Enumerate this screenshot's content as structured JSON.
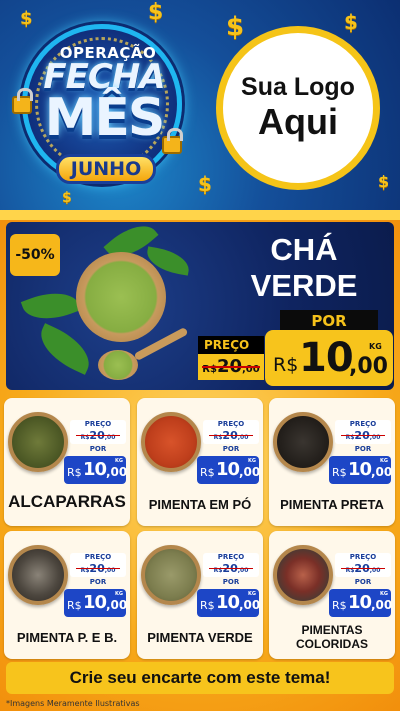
{
  "header": {
    "badge": {
      "line1": "OPERAÇÃO",
      "line2": "FECHA",
      "line3": "MÊS",
      "month": "JUNHO"
    },
    "logo": {
      "line1": "Sua Logo",
      "line2": "Aqui"
    },
    "dollar_symbol": "$"
  },
  "feature": {
    "discount": "-50%",
    "title_line1": "CHÁ",
    "title_line2": "VERDE",
    "por_label": "POR",
    "preco_label": "PREÇO",
    "old_currency": "R$",
    "old_price": "20",
    "old_cents": ",00",
    "currency": "R$",
    "price_int": "10",
    "price_dec": ",00",
    "unit": "KG"
  },
  "cards": [
    {
      "name": "ALCAPARRAS",
      "preco_label": "PREÇO",
      "old_currency": "R$",
      "old_price": "20",
      "old_cents": ",00",
      "por_label": "POR",
      "currency": "R$",
      "price_int": "10",
      "price_dec": ",00",
      "unit": "KG"
    },
    {
      "name": "PIMENTA EM PÓ",
      "preco_label": "PREÇO",
      "old_currency": "R$",
      "old_price": "20",
      "old_cents": ",00",
      "por_label": "POR",
      "currency": "R$",
      "price_int": "10",
      "price_dec": ",00",
      "unit": "KG"
    },
    {
      "name": "PIMENTA PRETA",
      "preco_label": "PREÇO",
      "old_currency": "R$",
      "old_price": "20",
      "old_cents": ",00",
      "por_label": "POR",
      "currency": "R$",
      "price_int": "10",
      "price_dec": ",00",
      "unit": "KG"
    },
    {
      "name": "PIMENTA P. E B.",
      "preco_label": "PREÇO",
      "old_currency": "R$",
      "old_price": "20",
      "old_cents": ",00",
      "por_label": "POR",
      "currency": "R$",
      "price_int": "10",
      "price_dec": ",00",
      "unit": "KG"
    },
    {
      "name": "PIMENTA VERDE",
      "preco_label": "PREÇO",
      "old_currency": "R$",
      "old_price": "20",
      "old_cents": ",00",
      "por_label": "POR",
      "currency": "R$",
      "price_int": "10",
      "price_dec": ",00",
      "unit": "KG"
    },
    {
      "name_line1": "PIMENTAS",
      "name_line2": "COLORIDAS",
      "preco_label": "PREÇO",
      "old_currency": "R$",
      "old_price": "20",
      "old_cents": ",00",
      "por_label": "POR",
      "currency": "R$",
      "price_int": "10",
      "price_dec": ",00",
      "unit": "KG"
    }
  ],
  "footer": {
    "cta": "Crie seu encarte com este tema!",
    "disclaimer": "*Imagens Meramente Ilustrativas"
  },
  "colors": {
    "header_blue": "#144f9a",
    "accent_yellow": "#f7c41c",
    "feature_navy": "#0f2460",
    "price_blue": "#1d46c6",
    "card_bg": "#fff8ea"
  },
  "icons": [
    "dollar-icon",
    "padlock-icon"
  ]
}
